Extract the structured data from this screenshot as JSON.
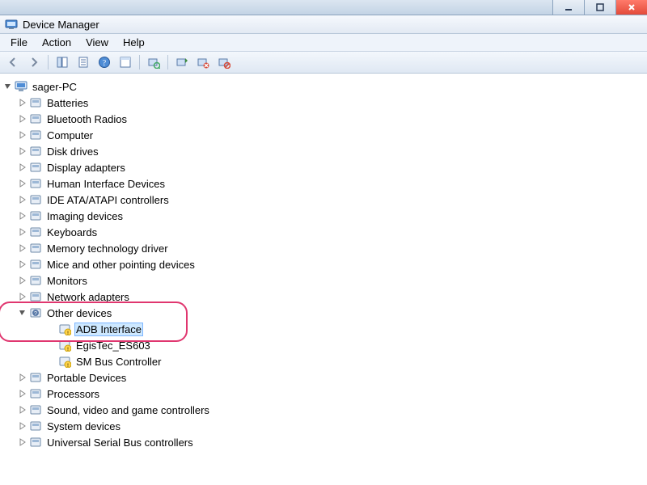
{
  "window": {
    "title": "Device Manager"
  },
  "menus": {
    "file": "File",
    "action": "Action",
    "view": "View",
    "help": "Help"
  },
  "tree": {
    "root": "sager-PC",
    "categories": [
      {
        "label": "Batteries"
      },
      {
        "label": "Bluetooth Radios"
      },
      {
        "label": "Computer"
      },
      {
        "label": "Disk drives"
      },
      {
        "label": "Display adapters"
      },
      {
        "label": "Human Interface Devices"
      },
      {
        "label": "IDE ATA/ATAPI controllers"
      },
      {
        "label": "Imaging devices"
      },
      {
        "label": "Keyboards"
      },
      {
        "label": "Memory technology driver"
      },
      {
        "label": "Mice and other pointing devices"
      },
      {
        "label": "Monitors"
      },
      {
        "label": "Network adapters"
      },
      {
        "label": "Other devices",
        "expanded": true,
        "children": [
          {
            "label": "ADB Interface",
            "selected": true
          },
          {
            "label": "EgisTec_ES603"
          },
          {
            "label": "SM Bus Controller"
          }
        ]
      },
      {
        "label": "Portable Devices"
      },
      {
        "label": "Processors"
      },
      {
        "label": "Sound, video and game controllers"
      },
      {
        "label": "System devices"
      },
      {
        "label": "Universal Serial Bus controllers"
      }
    ]
  },
  "annotation": {
    "highlight_color": "#e0366f"
  }
}
